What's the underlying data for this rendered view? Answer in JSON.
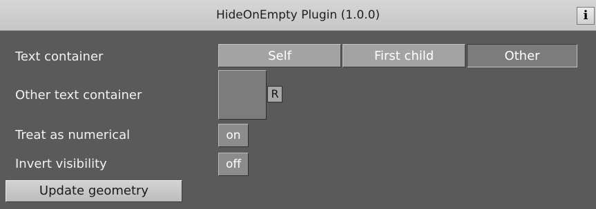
{
  "window": {
    "title": "HideOnEmpty Plugin (1.0.0)",
    "info_glyph": "i"
  },
  "text_container": {
    "label": "Text container",
    "options": [
      "Self",
      "First child",
      "Other"
    ],
    "selected": "Other"
  },
  "other_text_container": {
    "label": "Other text container",
    "reset_label": "R"
  },
  "treat_numerical": {
    "label": "Treat as numerical",
    "value": "on"
  },
  "invert_visibility": {
    "label": "Invert visibility",
    "value": "off"
  },
  "update_button": {
    "label": "Update geometry"
  },
  "colors": {
    "panel_bg": "#5a5a5a",
    "titlebar_bg": "#cfcfcf",
    "segment_bg": "#a3a3a3",
    "segment_selected_bg": "#7c7c7c"
  }
}
